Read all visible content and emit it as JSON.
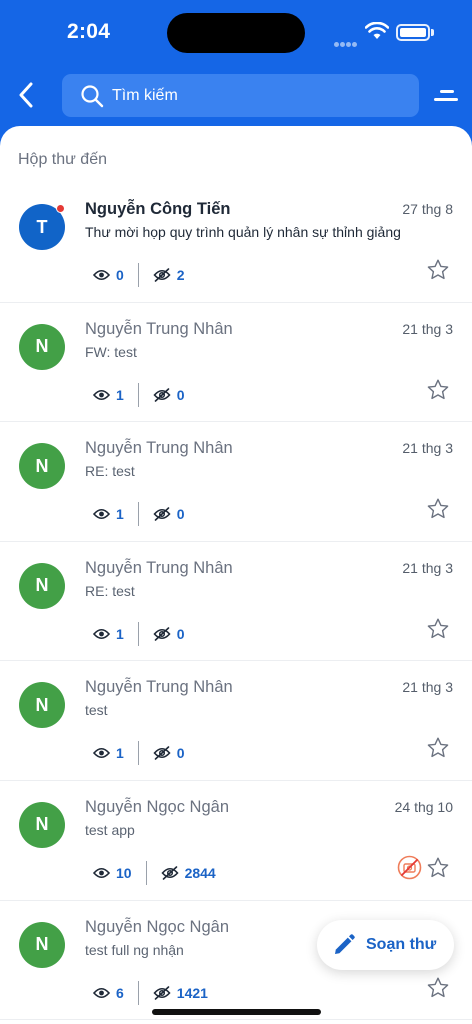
{
  "status_bar": {
    "time": "2:04"
  },
  "header": {
    "search_placeholder": "Tìm kiếm"
  },
  "section_title": "Hộp thư đến",
  "mails": [
    {
      "avatar": "T",
      "sender": "Nguyễn Công Tiến",
      "date": "27 thg 8",
      "subject": "Thư mời họp quy trình quản lý nhân sự thỉnh giảng",
      "read_count": "0",
      "unread_count": "2",
      "unread": true
    },
    {
      "avatar": "N",
      "sender": "Nguyễn Trung Nhân",
      "date": "21 thg 3",
      "subject": "FW: test",
      "read_count": "1",
      "unread_count": "0",
      "unread": false
    },
    {
      "avatar": "N",
      "sender": "Nguyễn Trung Nhân",
      "date": "21 thg 3",
      "subject": "RE: test",
      "read_count": "1",
      "unread_count": "0",
      "unread": false
    },
    {
      "avatar": "N",
      "sender": "Nguyễn Trung Nhân",
      "date": "21 thg 3",
      "subject": "RE: test",
      "read_count": "1",
      "unread_count": "0",
      "unread": false
    },
    {
      "avatar": "N",
      "sender": "Nguyễn Trung Nhân",
      "date": "21 thg 3",
      "subject": "test",
      "read_count": "1",
      "unread_count": "0",
      "unread": false
    },
    {
      "avatar": "N",
      "sender": "Nguyễn Ngọc Ngân",
      "date": "24 thg 10",
      "subject": "test app",
      "read_count": "10",
      "unread_count": "2844",
      "unread": false
    },
    {
      "avatar": "N",
      "sender": "Nguyễn Ngọc Ngân",
      "date": "",
      "subject": "test full ng nhận",
      "read_count": "6",
      "unread_count": "1421",
      "unread": false
    }
  ],
  "fab": {
    "label": "Soạn thư"
  },
  "colors": {
    "header_bg": "#1566e6",
    "accent": "#1b63c6",
    "avatar_green": "#43a047",
    "avatar_blue": "#1164c8",
    "unread_dot": "#e53935"
  }
}
